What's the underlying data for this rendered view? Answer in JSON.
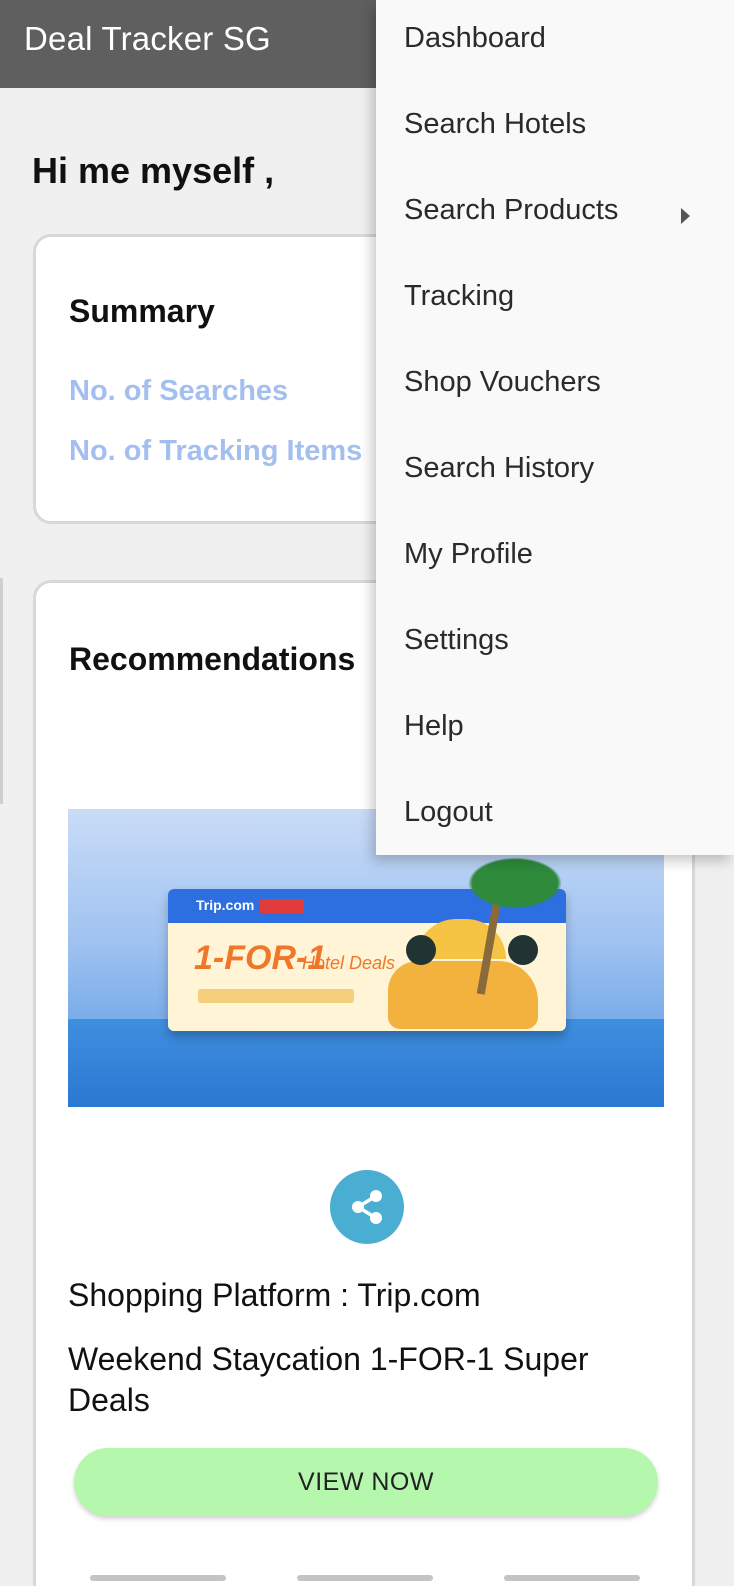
{
  "app_bar": {
    "title": "Deal Tracker SG"
  },
  "greeting": "Hi me myself ,",
  "summary": {
    "title": "Summary",
    "searches_label": "No. of Searches",
    "tracking_label": "No. of Tracking Items"
  },
  "recommendations": {
    "title": "Recommendations",
    "banner": {
      "brand": "Trip.com",
      "headline": "1-FOR-1",
      "subheadline": "Hotel Deals"
    },
    "share_icon": "share-icon",
    "platform_text": "Shopping Platform : Trip.com",
    "deal_title": "Weekend Staycation 1-FOR-1 Super Deals",
    "view_button": "VIEW NOW"
  },
  "menu": {
    "items": [
      {
        "label": "Dashboard"
      },
      {
        "label": "Search Hotels"
      },
      {
        "label": "Search Products",
        "has_submenu": true
      },
      {
        "label": "Tracking"
      },
      {
        "label": "Shop Vouchers"
      },
      {
        "label": "Search History"
      },
      {
        "label": "My Profile"
      },
      {
        "label": "Settings"
      },
      {
        "label": "Help"
      },
      {
        "label": "Logout"
      }
    ]
  },
  "colors": {
    "app_bar": "#5f5f5f",
    "summary_link": "#a3bff0",
    "share_button": "#4aaed2",
    "view_button": "#b4f7ad"
  }
}
